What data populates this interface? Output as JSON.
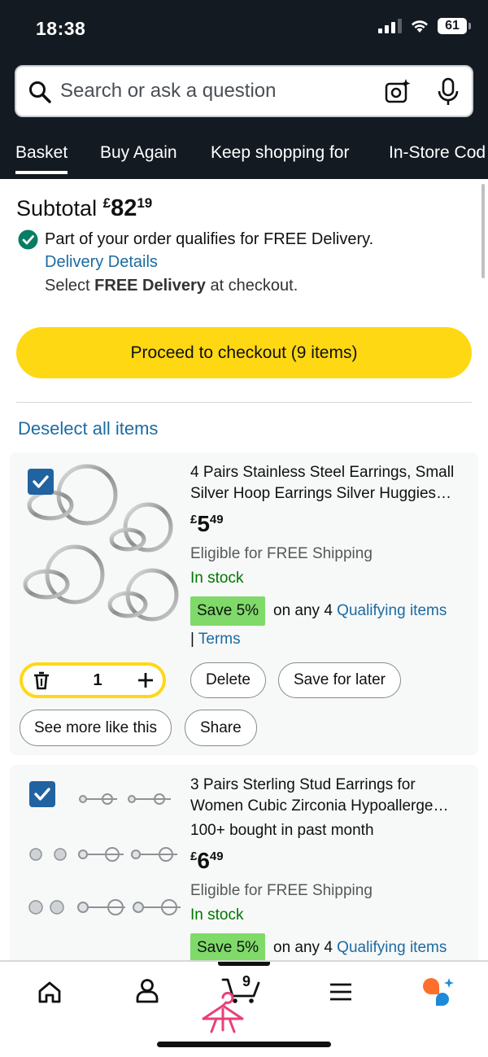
{
  "status": {
    "time": "18:38",
    "battery": "61"
  },
  "search": {
    "placeholder": "Search or ask a question"
  },
  "tabs": [
    {
      "label": "Basket",
      "active": true
    },
    {
      "label": "Buy Again"
    },
    {
      "label": "Keep shopping for"
    },
    {
      "label": "In-Store Cod"
    }
  ],
  "subtotal": {
    "label": "Subtotal",
    "currency": "£",
    "whole": "82",
    "fraction": "19"
  },
  "delivery": {
    "qualifies_text": "Part of your order qualifies for FREE Delivery.",
    "details_link": "Delivery Details",
    "select_prefix": "Select ",
    "select_bold": "FREE Delivery",
    "select_suffix": " at checkout."
  },
  "checkout": {
    "label": "Proceed to checkout (9 items)"
  },
  "deselect_label": "Deselect all items",
  "items": [
    {
      "title_line1": "4 Pairs Stainless Steel Earrings, Small",
      "title_line2": "Silver Hoop Earrings Silver Huggies…",
      "currency": "£",
      "price_whole": "5",
      "price_fraction": "49",
      "shipping": "Eligible for FREE Shipping",
      "stock": "In stock",
      "save_badge": "Save 5%",
      "save_text": "on any 4 ",
      "qualifying": "Qualifying items",
      "terms_prefix": "| ",
      "terms": "Terms",
      "quantity": "1",
      "delete_label": "Delete",
      "save_later_label": "Save for later",
      "see_more_label": "See more like this",
      "share_label": "Share",
      "checked": true
    },
    {
      "title_line1": "3 Pairs Sterling Stud Earrings for",
      "title_line2": "Women Cubic Zirconia Hypoallerge…",
      "bought": "100+ bought in past month",
      "currency": "£",
      "price_whole": "6",
      "price_fraction": "49",
      "shipping": "Eligible for FREE Shipping",
      "stock": "In stock",
      "save_badge": "Save 5%",
      "save_text": "on any 4 ",
      "qualifying": "Qualifying items",
      "checked": true
    }
  ],
  "bottom_nav": {
    "items": [
      "home-icon",
      "account-icon",
      "cart-icon",
      "menu-icon",
      "assistant-icon"
    ],
    "cart_count": "9"
  },
  "colors": {
    "header_bg": "#131a22",
    "checkout_yellow": "#ffd814",
    "link_blue": "#1c6ba0",
    "stock_green": "#007600",
    "save_badge_green": "#7fda69",
    "checkbox_blue": "#2162a1"
  }
}
